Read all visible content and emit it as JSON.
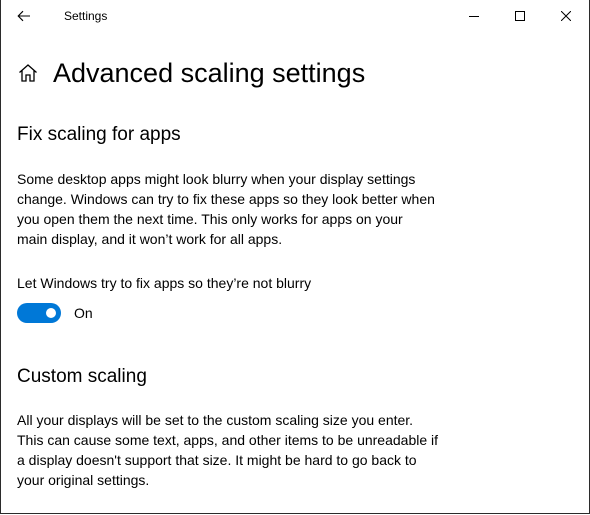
{
  "window": {
    "title": "Settings",
    "back_icon": "back-arrow-icon",
    "controls": [
      "minimize-icon",
      "maximize-icon",
      "close-icon"
    ]
  },
  "page": {
    "home_icon": "home-icon",
    "title": "Advanced scaling settings"
  },
  "fix_section": {
    "heading": "Fix scaling for apps",
    "description_lines": [
      "Some desktop apps might look blurry when your display settings",
      "change. Windows can try to fix these apps so they look better when",
      "you open them the next time. This only works for apps on your",
      "main display, and it won’t work for all apps."
    ],
    "toggle_label": "Let Windows try to fix apps so they’re not blurry",
    "toggle_state": "On",
    "toggle_on": true
  },
  "custom_section": {
    "heading": "Custom scaling",
    "description_lines": [
      "All your displays will be set to the custom scaling size you enter.",
      "This can cause some text, apps, and other items to be unreadable if",
      "a display doesn't support that size. It might be hard to go back to",
      "your original settings."
    ]
  },
  "colors": {
    "accent": "#0078d7",
    "background": "#ffffff",
    "text": "#000000"
  }
}
